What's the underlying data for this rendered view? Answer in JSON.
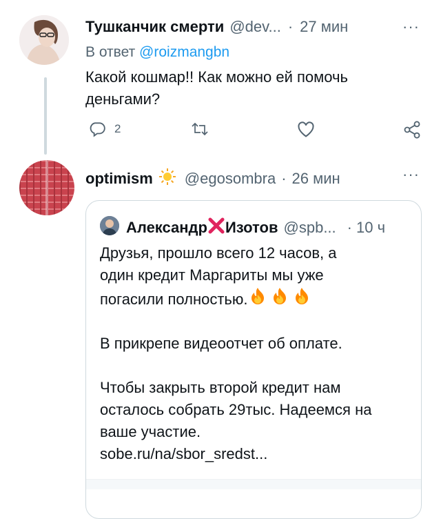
{
  "tweet1": {
    "author_name": "Тушканчик смерти",
    "handle": "@dev...",
    "separator": "·",
    "time": "27 мин",
    "more": "···",
    "reply_prefix": "В ответ",
    "reply_to": "@roizmangbn",
    "text": "Какой кошмар!! Как можно ей помочь деньгами?",
    "reply_count": "2",
    "icons": [
      "reply-icon",
      "retweet-icon",
      "like-icon",
      "share-icon"
    ]
  },
  "tweet2": {
    "author_name": "optimism",
    "name_emoji": "sun-emoji",
    "handle": "@egosombra",
    "separator": "·",
    "time": "26 мин",
    "more": "···",
    "quote": {
      "author_first": "Александр",
      "author_emoji": "cross-mark-emoji",
      "author_last": "Изотов",
      "handle": "@spb...",
      "separator": "·",
      "time": "10 ч",
      "line1": "Друзья, прошло всего 12 часов, а",
      "line2": "один кредит Маргариты мы уже",
      "line3": "погасили полностью.",
      "line3_emoji": "fire-emoji ×3",
      "para2": "В прикрепе видеоотчет об оплате.",
      "para3_line1": "Чтобы закрыть второй кредит нам",
      "para3_line2": "осталось собрать 29тыс. Надеемся на",
      "para3_line3": "ваше участие.",
      "link": "sobe.ru/na/sbor_sredst..."
    }
  },
  "colors": {
    "text": "#0f1419",
    "secondary": "#536471",
    "link": "#1d9bf0",
    "border": "#cfd9de",
    "cross": "#e0245e",
    "fire": "#ff8a00"
  }
}
